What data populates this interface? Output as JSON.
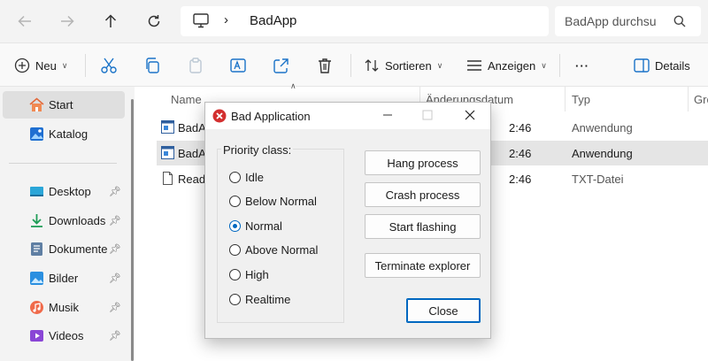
{
  "address_bar": {
    "breadcrumb": "BadApp",
    "search_placeholder": "BadApp durchsu"
  },
  "toolbar": {
    "new_label": "Neu",
    "sort_label": "Sortieren",
    "view_label": "Anzeigen",
    "more_label": "···",
    "details_label": "Details"
  },
  "sidebar": {
    "items": [
      {
        "label": "Start",
        "icon": "home-icon"
      },
      {
        "label": "Katalog",
        "icon": "gallery-icon"
      },
      {
        "label": "Desktop",
        "icon": "desktop-folder-icon"
      },
      {
        "label": "Downloads",
        "icon": "downloads-folder-icon"
      },
      {
        "label": "Dokumente",
        "icon": "documents-folder-icon"
      },
      {
        "label": "Bilder",
        "icon": "pictures-folder-icon"
      },
      {
        "label": "Musik",
        "icon": "music-folder-icon"
      },
      {
        "label": "Videos",
        "icon": "videos-folder-icon"
      }
    ]
  },
  "file_list": {
    "columns": [
      "Name",
      "Änderungsdatum",
      "Typ",
      "Grö"
    ],
    "rows": [
      {
        "name": "BadA",
        "date": "2:46",
        "type": "Anwendung"
      },
      {
        "name": "BadA",
        "date": "2:46",
        "type": "Anwendung"
      },
      {
        "name": "ReadM",
        "date": "2:46",
        "type": "TXT-Datei"
      }
    ]
  },
  "dialog": {
    "title": "Bad Application",
    "group_label": "Priority class:",
    "options": [
      "Idle",
      "Below Normal",
      "Normal",
      "Above Normal",
      "High",
      "Realtime"
    ],
    "selected_option": "Normal",
    "buttons": {
      "hang": "Hang process",
      "crash": "Crash process",
      "flash": "Start flashing",
      "terminate": "Terminate explorer",
      "close": "Close"
    }
  },
  "colors": {
    "accent": "#0067c0",
    "error_icon": "#d32f2f"
  }
}
